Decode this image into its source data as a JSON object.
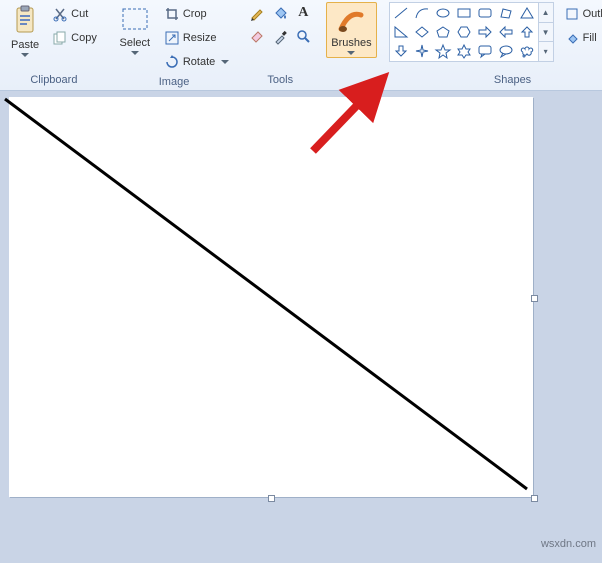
{
  "ribbon": {
    "clipboard": {
      "label": "Clipboard",
      "paste": "Paste",
      "cut": "Cut",
      "copy": "Copy"
    },
    "image": {
      "label": "Image",
      "select": "Select",
      "crop": "Crop",
      "resize": "Resize",
      "rotate": "Rotate"
    },
    "tools": {
      "label": "Tools"
    },
    "brushes": {
      "label": "Brushes"
    },
    "shapes": {
      "label": "Shapes",
      "outline": "Outline",
      "fill": "Fill"
    }
  },
  "watermark": "wsxdn.com",
  "colors": {
    "shape_stroke": "#2b5fa4",
    "arrow": "#d81e1e"
  }
}
